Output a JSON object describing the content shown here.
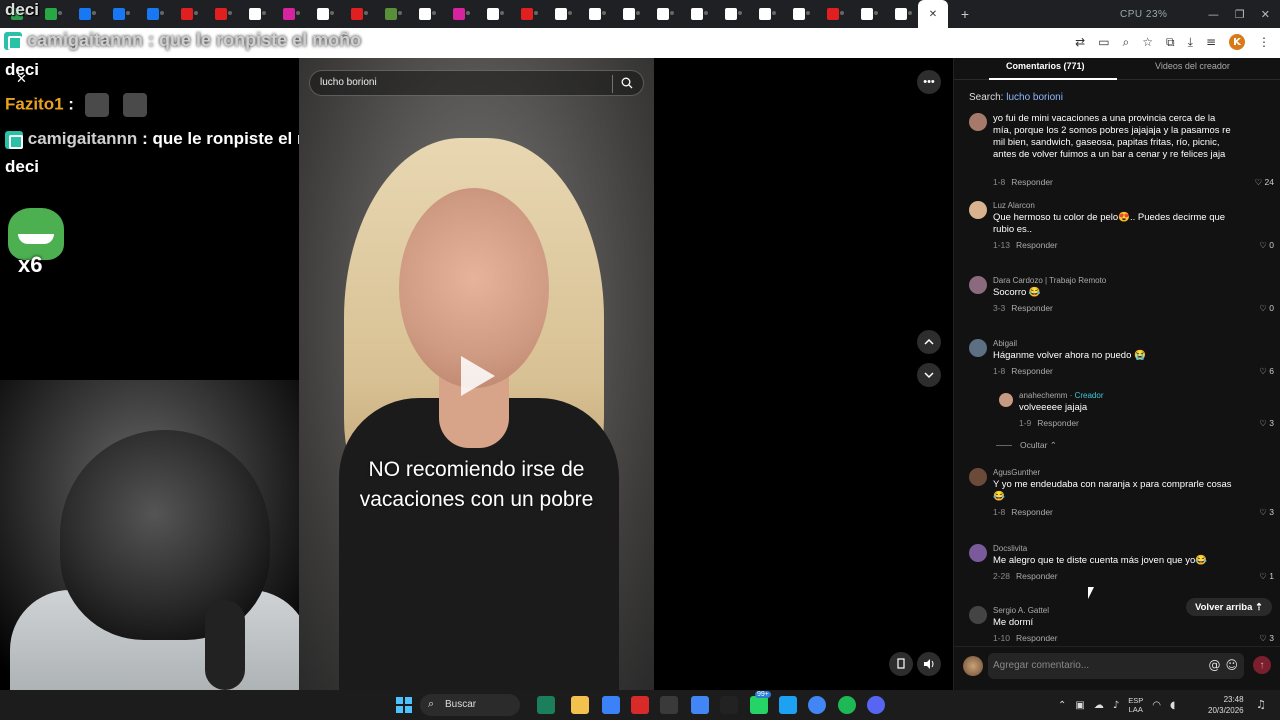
{
  "browser": {
    "tabs": [
      {
        "color": "#2a9d4a"
      },
      {
        "color": "#28a745"
      },
      {
        "color": "#1877f2"
      },
      {
        "color": "#1877f2"
      },
      {
        "color": "#1877f2"
      },
      {
        "color": "#e02020"
      },
      {
        "color": "#e02020"
      },
      {
        "color": "#ffffff"
      },
      {
        "color": "#d6249f"
      },
      {
        "color": "#ffffff"
      },
      {
        "color": "#e02020"
      },
      {
        "color": "#5a8f3a"
      },
      {
        "color": "#ffffff"
      },
      {
        "color": "#d6249f"
      },
      {
        "color": "#ffffff"
      },
      {
        "color": "#e02020"
      },
      {
        "color": "#ffffff"
      },
      {
        "color": "#ffffff"
      },
      {
        "color": "#ffffff"
      },
      {
        "color": "#ffffff"
      },
      {
        "color": "#ffffff"
      },
      {
        "color": "#ffffff"
      },
      {
        "color": "#ffffff"
      },
      {
        "color": "#ffffff"
      },
      {
        "color": "#e02020"
      },
      {
        "color": "#ffffff"
      },
      {
        "color": "#ffffff"
      }
    ],
    "active_tab_close": "✕",
    "stats_cpu": "CPU 23%",
    "new_tab": "+",
    "minimize": "—",
    "maximize": "❐",
    "close": "✕",
    "profile_initial": "K"
  },
  "overlay": {
    "top_user": "camigaitannn",
    "top_message": ": que le ronpiste el moño",
    "close_icon": "✕",
    "line1": "deci",
    "line2_user": "Fazito1",
    "line2_sep": ":",
    "line3_user": "camigaitannn",
    "line3_msg": ": que le ronpiste el moño",
    "line4": "deci",
    "emote_multiplier": "x6"
  },
  "video": {
    "search_text": "lucho borioni",
    "caption_line1": "NO recomiendo irse de",
    "caption_line2": "vacaciones con un pobre",
    "more_icon": "•••"
  },
  "panel": {
    "tab_comments": "Comentarios (771)",
    "tab_videos": "Videos del creador",
    "search_label": "Search:",
    "search_term": "lucho borioni",
    "comments": [
      {
        "name": "",
        "text": "yo fui de mini vacaciones a una provincia cerca de la mía, porque los 2 somos pobres jajajaja y la pasamos re mil bien, sandwich, gaseosa, papitas fritas, río, picnic, antes de volver fuimos a un bar a cenar y re felices jaja",
        "date": "1-8",
        "reply": "Responder",
        "likes": "24",
        "avatar": "#a57a6a"
      },
      {
        "name": "Luz Alarcon",
        "text": "Que hermoso tu color de pelo😍.. Puedes decirme que rubio es..",
        "date": "1-13",
        "reply": "Responder",
        "likes": "0",
        "avatar": "#d9b38f"
      },
      {
        "name": "Dara Cardozo | Trabajo Remoto",
        "text": "Socorro 😂",
        "date": "3-3",
        "reply": "Responder",
        "likes": "0",
        "avatar": "#8b6a7d"
      },
      {
        "name": "Abigail",
        "text": "Háganme volver ahora no puedo 😭",
        "date": "1-8",
        "reply": "Responder",
        "likes": "6",
        "avatar": "#5d6f82"
      },
      {
        "name": "anahechemm",
        "creator": "· Creador",
        "text": "volveeeee jajaja",
        "date": "1-9",
        "reply": "Responder",
        "likes": "3",
        "avatar": "#c79a84"
      },
      {
        "name": "AgusGunther",
        "text": "Y yo me endeudaba con naranja x para comprarle cosas 😂",
        "date": "1-8",
        "reply": "Responder",
        "likes": "3",
        "avatar": "#6b4a3a"
      },
      {
        "name": "Docslivita",
        "text": "Me alegro que te diste cuenta más joven que yo😂",
        "date": "2-28",
        "reply": "Responder",
        "likes": "1",
        "avatar": "#7a5a9a"
      },
      {
        "name": "Sergio A. Gattel",
        "text": "Me dormí",
        "date": "1-10",
        "reply": "Responder",
        "likes": "3",
        "avatar": "#444444"
      }
    ],
    "hide_replies": "Ocultar ⌃",
    "back_to_top": "Volver arriba ⇡",
    "comment_placeholder": "Agregar comentario...",
    "mention_icon": "@",
    "emoji_icon": "☺",
    "send_icon": "↑"
  },
  "taskbar": {
    "search": "Buscar",
    "lang_line1": "ESP",
    "lang_line2": "LAA",
    "time": "23:48",
    "date": "20/3/2026",
    "app_colors": [
      "#1a7f5a",
      "#f2c14e",
      "#3b82f6",
      "#d92a2a",
      "#3a3a3a",
      "#4285f4",
      "#222222",
      "#25d366",
      "#1da1f2",
      "#4285f4",
      "#1db954",
      "#5865f2"
    ],
    "badge": "99+"
  }
}
